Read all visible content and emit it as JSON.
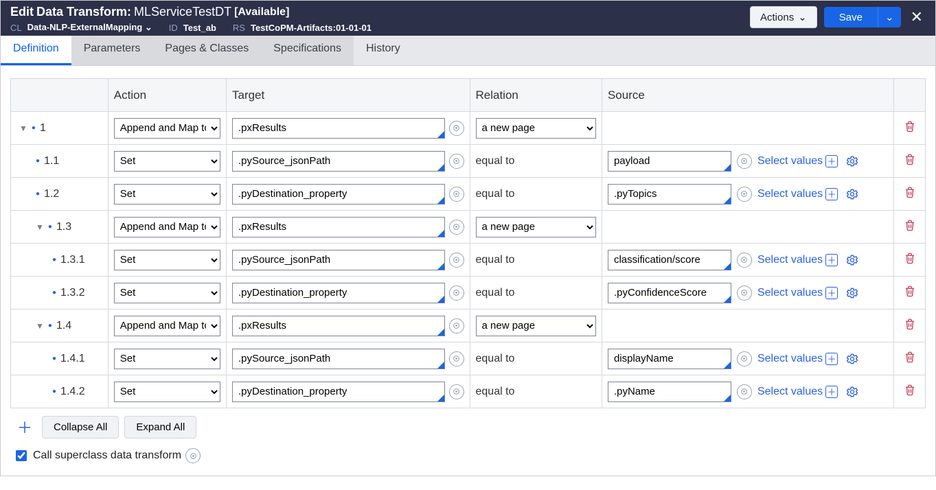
{
  "header": {
    "edit": "Edit",
    "rule_type": "Data Transform:",
    "name": "MLServiceTestDT",
    "status": "[Available]",
    "cl_label": "CL",
    "cl_value": "Data-NLP-ExternalMapping",
    "id_label": "ID",
    "id_value": "Test_ab",
    "rs_label": "RS",
    "rs_value": "TestCoPM-Artifacts:01-01-01",
    "actions": "Actions",
    "save": "Save"
  },
  "tabs": [
    "Definition",
    "Parameters",
    "Pages & Classes",
    "Specifications",
    "History"
  ],
  "columns": {
    "action": "Action",
    "target": "Target",
    "relation": "Relation",
    "source": "Source"
  },
  "actions_opts": {
    "append": "Append and Map to",
    "set": "Set"
  },
  "relations": {
    "newpage": "a new page",
    "equal": "equal to"
  },
  "select_values": "Select values",
  "rows": [
    {
      "num": "1",
      "indent": 0,
      "caret": true,
      "action": "append",
      "target": ".pxResults",
      "rel_type": "sel",
      "rel": "newpage",
      "source": "",
      "has_sv": false
    },
    {
      "num": "1.1",
      "indent": 1,
      "caret": false,
      "action": "set",
      "target": ".pySource_jsonPath",
      "rel_type": "text",
      "rel": "equal",
      "source": "payload",
      "has_sv": true
    },
    {
      "num": "1.2",
      "indent": 1,
      "caret": false,
      "action": "set",
      "target": ".pyDestination_property",
      "rel_type": "text",
      "rel": "equal",
      "source": ".pyTopics",
      "has_sv": true
    },
    {
      "num": "1.3",
      "indent": 1,
      "caret": true,
      "action": "append",
      "target": ".pxResults",
      "rel_type": "sel",
      "rel": "newpage",
      "source": "",
      "has_sv": false
    },
    {
      "num": "1.3.1",
      "indent": 2,
      "caret": false,
      "action": "set",
      "target": ".pySource_jsonPath",
      "rel_type": "text",
      "rel": "equal",
      "source": "classification/score",
      "has_sv": true
    },
    {
      "num": "1.3.2",
      "indent": 2,
      "caret": false,
      "action": "set",
      "target": ".pyDestination_property",
      "rel_type": "text",
      "rel": "equal",
      "source": ".pyConfidenceScore",
      "has_sv": true
    },
    {
      "num": "1.4",
      "indent": 1,
      "caret": true,
      "action": "append",
      "target": ".pxResults",
      "rel_type": "sel",
      "rel": "newpage",
      "source": "",
      "has_sv": false
    },
    {
      "num": "1.4.1",
      "indent": 2,
      "caret": false,
      "action": "set",
      "target": ".pySource_jsonPath",
      "rel_type": "text",
      "rel": "equal",
      "source": "displayName",
      "has_sv": true
    },
    {
      "num": "1.4.2",
      "indent": 2,
      "caret": false,
      "action": "set",
      "target": ".pyDestination_property",
      "rel_type": "text",
      "rel": "equal",
      "source": ".pyName",
      "has_sv": true
    }
  ],
  "footer": {
    "collapse": "Collapse All",
    "expand": "Expand All",
    "super": "Call superclass data transform",
    "super_checked": true
  }
}
